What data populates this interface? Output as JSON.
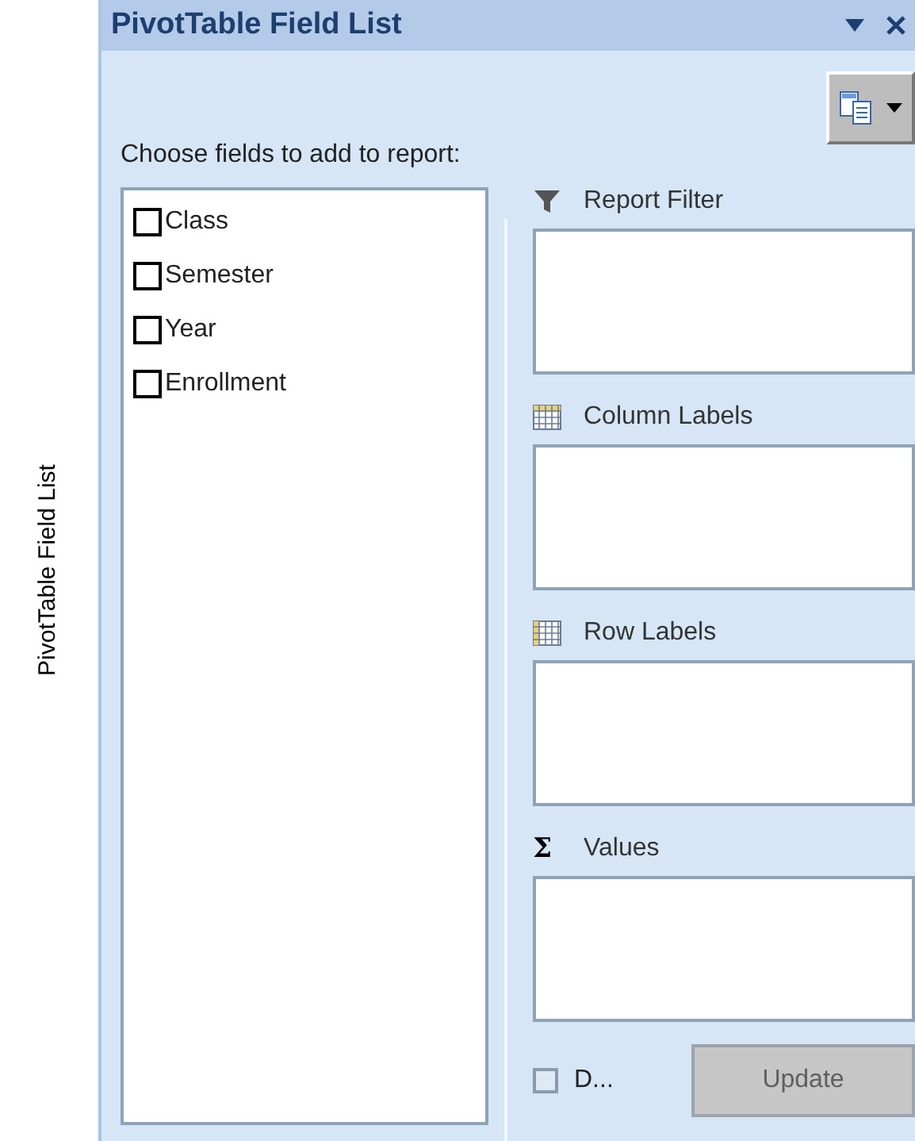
{
  "side_label": "PivotTable Field List",
  "title": "PivotTable Field List",
  "prompt": "Choose fields to add to report:",
  "fields": [
    {
      "label": "Class",
      "checked": false
    },
    {
      "label": "Semester",
      "checked": false
    },
    {
      "label": "Year",
      "checked": false
    },
    {
      "label": "Enrollment",
      "checked": false
    }
  ],
  "areas": [
    {
      "kind": "filter",
      "label": "Report Filter"
    },
    {
      "kind": "columns",
      "label": "Column Labels"
    },
    {
      "kind": "rows",
      "label": "Row Labels"
    },
    {
      "kind": "values",
      "label": "Values",
      "symbol": "Σ"
    }
  ],
  "defer": {
    "label": "D...",
    "checked": false
  },
  "update_button": {
    "label": "Update",
    "disabled": true
  }
}
